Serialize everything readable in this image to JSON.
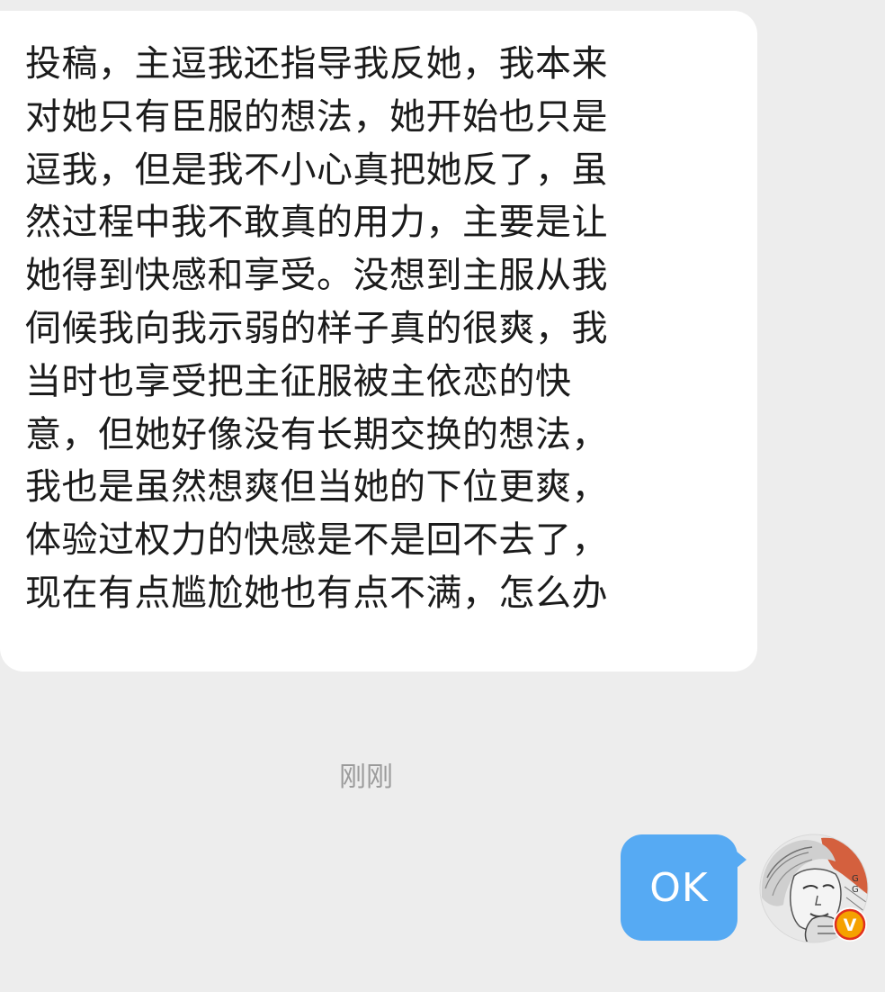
{
  "incoming": {
    "lines": [
      "投稿，主逗我还指导我反她，我本来",
      "对她只有臣服的想法，她开始也只是",
      "逗我，但是我不小心真把她反了，虽",
      "然过程中我不敢真的用力，主要是让",
      "她得到快感和享受。没想到主服从我",
      "伺候我向我示弱的样子真的很爽，我",
      "当时也享受把主征服被主依恋的快",
      "意，但她好像没有长期交换的想法，",
      "我也是虽然想爽但当她的下位更爽，",
      "体验过权力的快感是不是回不去了，",
      "现在有点尴尬她也有点不满，怎么办"
    ]
  },
  "timestamp": "刚刚",
  "outgoing": {
    "text": "OK"
  },
  "avatar": {
    "icon": "avatar-sketch-portrait",
    "badge_icon": "verified-v-icon",
    "badge_letter": "V",
    "badge_color": "#f5a100"
  },
  "colors": {
    "background": "#ededed",
    "incoming_bubble": "#ffffff",
    "outgoing_bubble": "#56aaf3",
    "timestamp": "#9b9b9b"
  }
}
